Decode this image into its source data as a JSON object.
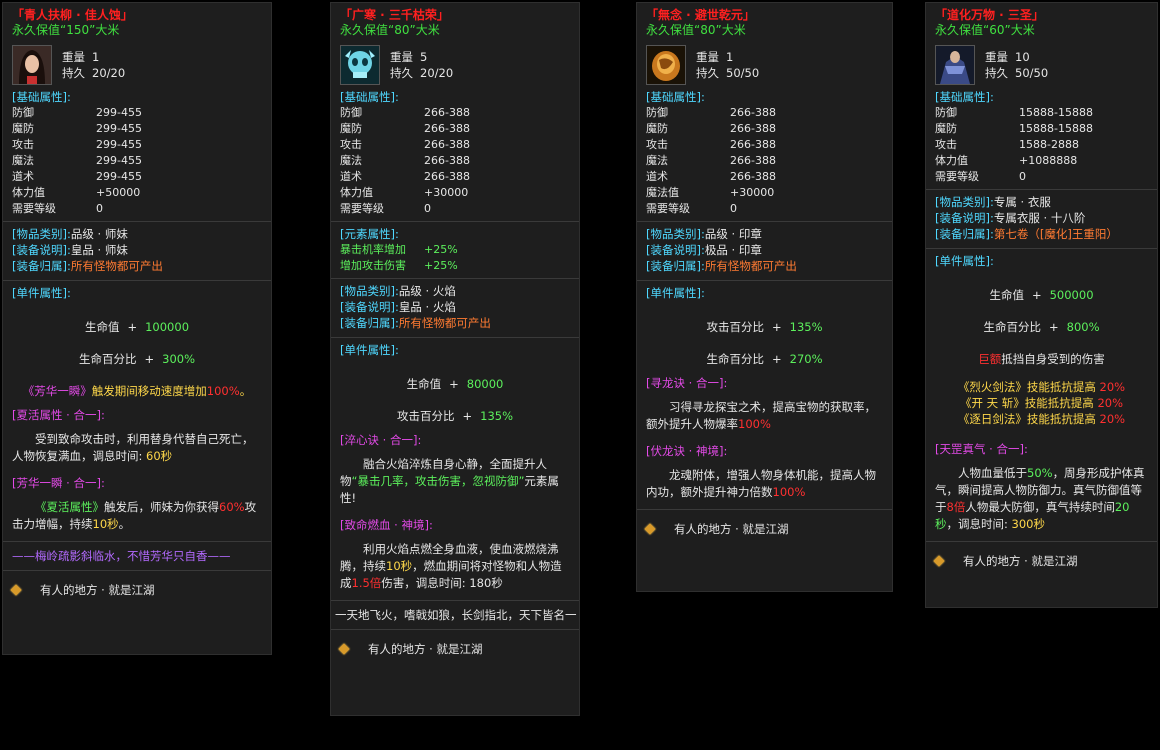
{
  "cards": [
    {
      "title": "「青人扶柳 · 佳人蚀」",
      "value_text": "永久保值“150”大米",
      "weight_label": "重量",
      "weight": "1",
      "durability_label": "持久",
      "durability": "20/20",
      "portrait_icon": "female-character-portrait-icon",
      "base_header": "[基础属性]:",
      "base_stats": [
        {
          "name": "防御",
          "value": "299-455"
        },
        {
          "name": "魔防",
          "value": "299-455"
        },
        {
          "name": "攻击",
          "value": "299-455"
        },
        {
          "name": "魔法",
          "value": "299-455"
        },
        {
          "name": "道术",
          "value": "299-455"
        },
        {
          "name": "体力值",
          "value": "+50000"
        },
        {
          "name": "需要等级",
          "value": "0"
        }
      ],
      "info": [
        {
          "k": "[物品类别]:",
          "v": "品级 · 师妹"
        },
        {
          "k": "[装备说明]:",
          "v": "皇品 · 师妹"
        },
        {
          "k": "[装备归属]:",
          "v": "所有怪物都可产出"
        }
      ],
      "single_header": "[单件属性]:",
      "single": [
        {
          "name": "生命值",
          "plus": "+",
          "value": "100000"
        },
        {
          "name": "生命百分比",
          "plus": "+",
          "value": "300%"
        }
      ],
      "effect": {
        "a": "《芳华一瞬》",
        "b": "触发期间移动速度增加",
        "c": "100%",
        "d": "。"
      },
      "sections": [
        {
          "header": "[夏活属性 · 合一]:",
          "text": "受到致命攻击时，利用替身代替自己死亡，人物恢复满血，调息时间: ",
          "hl": "60秒",
          "tail": ""
        },
        {
          "header": "[芳华一瞬 · 合一]:",
          "pre": "《夏活属性》",
          "text": "触发后，师妹为你获得",
          "hl": "60%",
          "tail": "攻击力增幅，持续",
          "hl2": "10秒",
          "tail2": "。"
        }
      ],
      "poem": "——梅岭疏影斜临水，不惜芳华只自香——",
      "footer": "有人的地方 · 就是江湖"
    },
    {
      "title": "「广寒 · 三千枯荣」",
      "value_text": "永久保值“80”大米",
      "weight_label": "重量",
      "weight": "5",
      "durability_label": "持久",
      "durability": "20/20",
      "portrait_icon": "ice-skull-icon",
      "base_header": "[基础属性]:",
      "base_stats": [
        {
          "name": "防御",
          "value": "266-388"
        },
        {
          "name": "魔防",
          "value": "266-388"
        },
        {
          "name": "攻击",
          "value": "266-388"
        },
        {
          "name": "魔法",
          "value": "266-388"
        },
        {
          "name": "道术",
          "value": "266-388"
        },
        {
          "name": "体力值",
          "value": "+30000"
        },
        {
          "name": "需要等级",
          "value": "0"
        }
      ],
      "element_header": "[元素属性]:",
      "elements": [
        {
          "name": "暴击机率增加",
          "value": "+25%"
        },
        {
          "name": "增加攻击伤害",
          "value": "+25%"
        }
      ],
      "info": [
        {
          "k": "[物品类别]:",
          "v": "品级 · 火焰"
        },
        {
          "k": "[装备说明]:",
          "v": "皇品 · 火焰"
        },
        {
          "k": "[装备归属]:",
          "v": "所有怪物都可产出"
        }
      ],
      "single_header": "[单件属性]:",
      "single": [
        {
          "name": "生命值",
          "plus": "+",
          "value": "80000"
        },
        {
          "name": "攻击百分比",
          "plus": "+",
          "value": "135%"
        }
      ],
      "sections": [
        {
          "header": "[淬心诀 · 合一]:",
          "text": "融合火焰淬炼自身心静，全面提升人物",
          "hl": "“暴击几率，攻击伤害，忽视防御”",
          "tail": "元素属性!"
        },
        {
          "header": "[致命燃血 · 神境]:",
          "text": "利用火焰点燃全身血液，使血液燃烧沸腾，持续",
          "hl": "10秒",
          "tail": "，燃血期间将对怪物和人物造成",
          "hl2": "1.5倍",
          "tail2": "伤害，调息时间: 180秒"
        }
      ],
      "poem": "一天地飞火，嗜戟如狼，长剑指北，天下皆名一",
      "footer": "有人的地方 · 就是江湖"
    },
    {
      "title": "「無念 · 避世乾元」",
      "value_text": "永久保值“80”大米",
      "weight_label": "重量",
      "weight": "1",
      "durability_label": "持久",
      "durability": "50/50",
      "portrait_icon": "amber-seal-icon",
      "base_header": "[基础属性]:",
      "base_stats": [
        {
          "name": "防御",
          "value": "266-388"
        },
        {
          "name": "魔防",
          "value": "266-388"
        },
        {
          "name": "攻击",
          "value": "266-388"
        },
        {
          "name": "魔法",
          "value": "266-388"
        },
        {
          "name": "道术",
          "value": "266-388"
        },
        {
          "name": "魔法值",
          "value": "+30000"
        },
        {
          "name": "需要等级",
          "value": "0"
        }
      ],
      "info": [
        {
          "k": "[物品类别]:",
          "v": "品级 · 印章"
        },
        {
          "k": "[装备说明]:",
          "v": "极品 · 印章"
        },
        {
          "k": "[装备归属]:",
          "v": "所有怪物都可产出"
        }
      ],
      "single_header": "[单件属性]:",
      "single": [
        {
          "name": "攻击百分比",
          "plus": "+",
          "value": "135%"
        },
        {
          "name": "生命百分比",
          "plus": "+",
          "value": "270%"
        }
      ],
      "sections": [
        {
          "header": "[寻龙诀 · 合一]:",
          "text": "习得寻龙探宝之术，提高宝物的获取率，额外提升人物爆率",
          "hl": "100%",
          "tail": ""
        },
        {
          "header": "[伏龙诀 · 神境]:",
          "text": "龙魂附体，增强人物身体机能，提高人物内功，额外提升神力倍数",
          "hl": "100%",
          "tail": ""
        }
      ],
      "footer": "有人的地方 · 就是江湖"
    },
    {
      "title": "「道化万物 · 三圣」",
      "value_text": "永久保值“60”大米",
      "weight_label": "重量",
      "weight": "10",
      "durability_label": "持久",
      "durability": "50/50",
      "portrait_icon": "armored-warrior-portrait-icon",
      "base_header": "[基础属性]:",
      "base_stats": [
        {
          "name": "防御",
          "value": "15888-15888"
        },
        {
          "name": "魔防",
          "value": "15888-15888"
        },
        {
          "name": "攻击",
          "value": "1588-2888"
        },
        {
          "name": "体力值",
          "value": "+1088888"
        },
        {
          "name": "需要等级",
          "value": "0"
        }
      ],
      "info": [
        {
          "k": "[物品类别]:",
          "v": "专属 · 衣服"
        },
        {
          "k": "[装备说明]:",
          "v": "专属衣服 · 十八阶"
        },
        {
          "k": "[装备归属]:",
          "v": "第七卷（[魔化]王重阳）"
        }
      ],
      "single_header": "[单件属性]:",
      "single": [
        {
          "name": "生命值",
          "plus": "+",
          "value": "500000"
        },
        {
          "name": "生命百分比",
          "plus": "+",
          "value": "800%"
        }
      ],
      "special": {
        "hl": "巨额",
        "text": "抵挡自身受到的伤害"
      },
      "resist": [
        {
          "skill": "《烈火剑法》",
          "text": "技能抵抗提高",
          "value": "20%"
        },
        {
          "skill": "《开 天 斩》",
          "text": "技能抵抗提高",
          "value": "20%"
        },
        {
          "skill": "《逐日剑法》",
          "text": "技能抵抗提高",
          "value": "20%"
        }
      ],
      "sections": [
        {
          "header": "[天罡真气 · 合一]:",
          "t1": "人物血量低于",
          "h1": "50%",
          "t2": "，周身形成护体真气，瞬间提高人物防御力。真气防御值等于",
          "h2": "8倍",
          "t3": "人物最大防御，真气持续时间",
          "h3": "20秒",
          "t4": "，调息时间: ",
          "h4": "300秒"
        }
      ],
      "footer": "有人的地方 · 就是江湖"
    }
  ]
}
